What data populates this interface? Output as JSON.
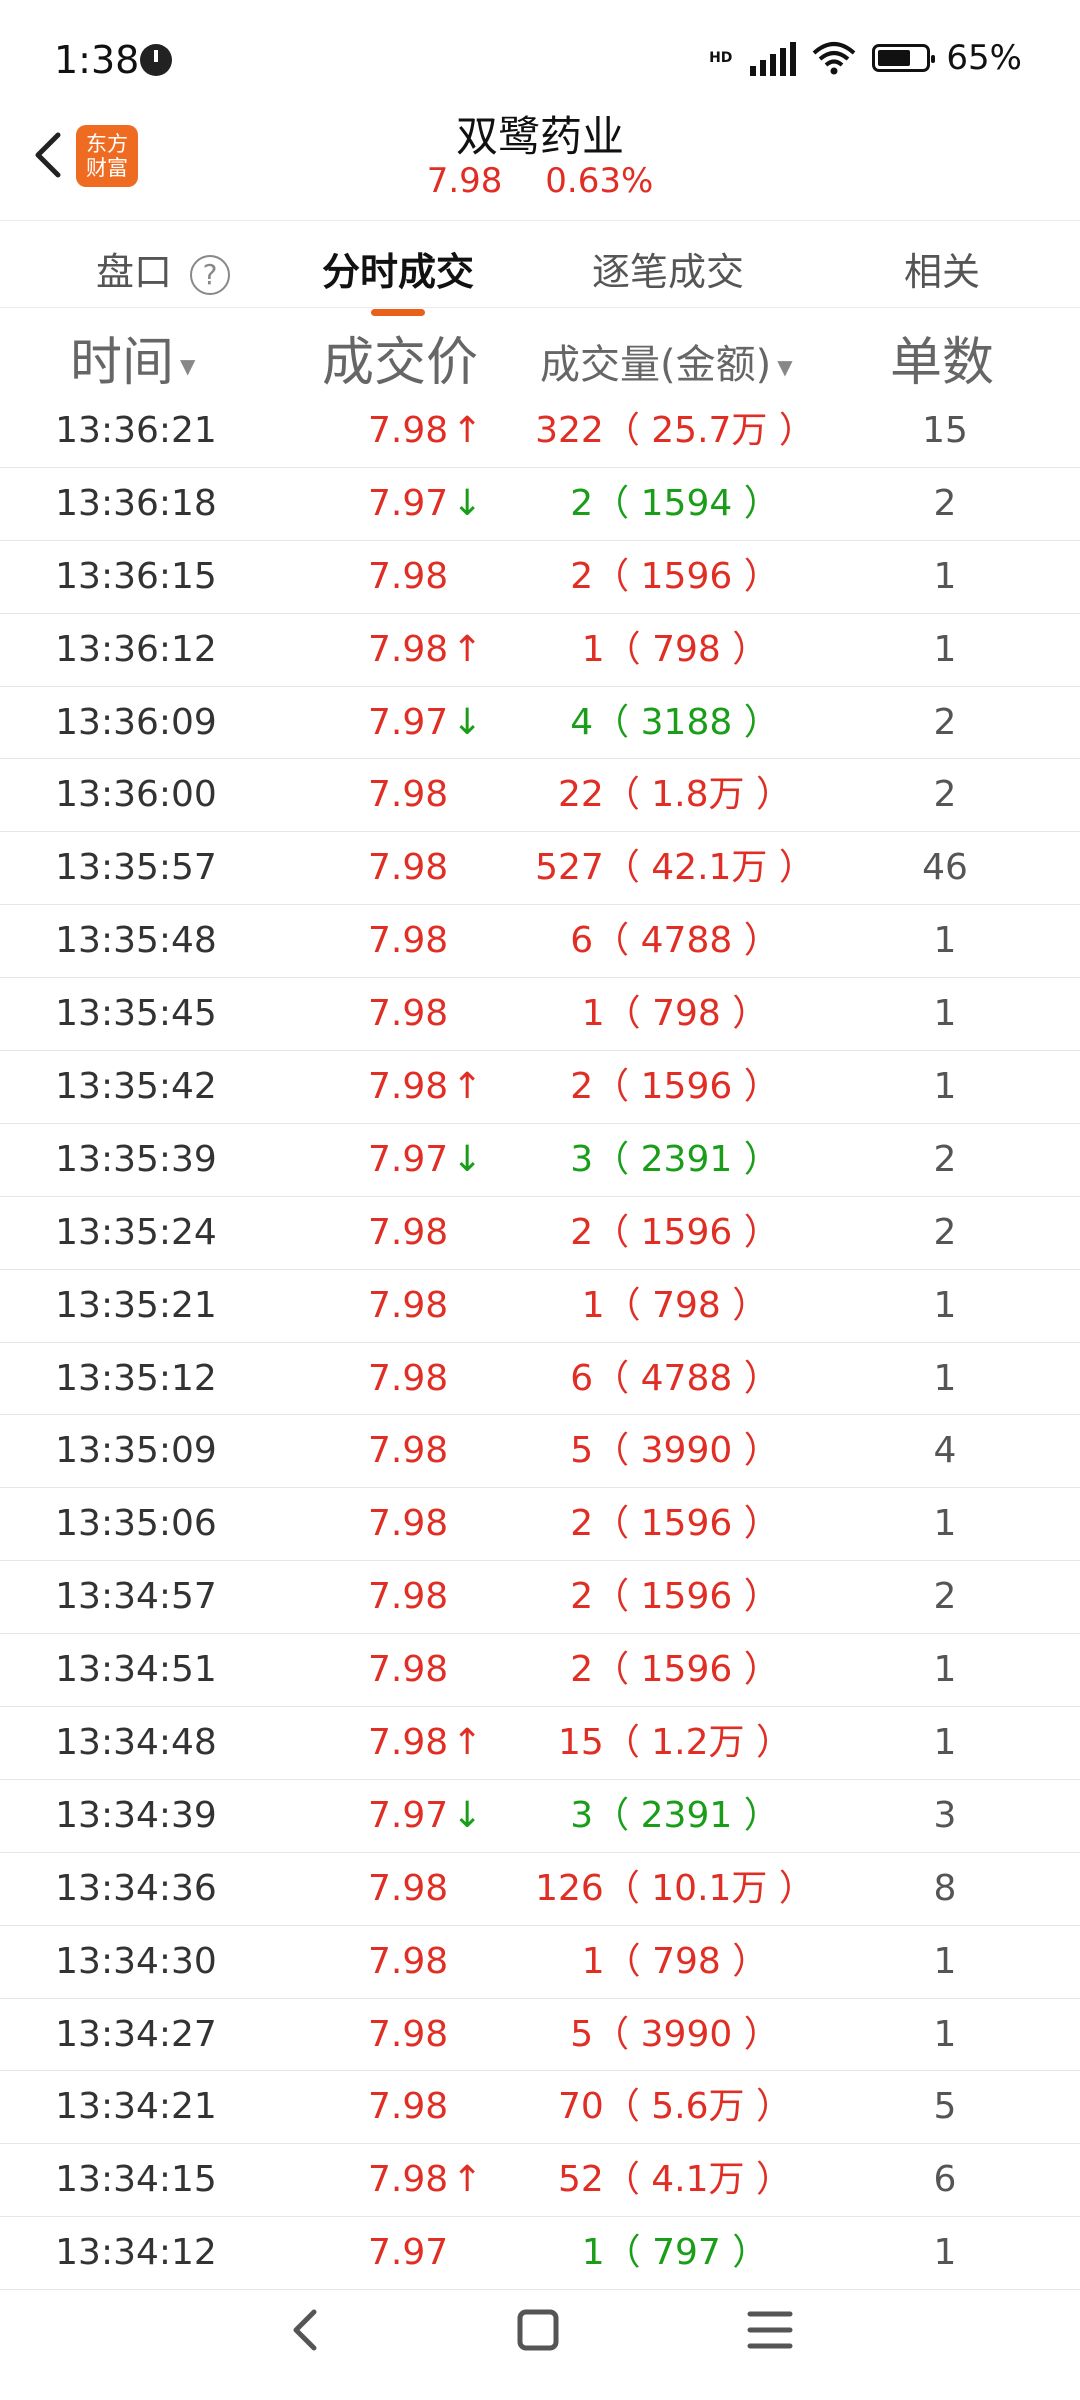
{
  "status": {
    "time": "1:38",
    "signal": "HD",
    "battery": "65%"
  },
  "header": {
    "title": "双鹭药业",
    "price": "7.98",
    "change": "0.63%",
    "logo_line1": "东方",
    "logo_line2": "财富"
  },
  "tabs": [
    {
      "label": "盘口",
      "active": false
    },
    {
      "label": "分时成交",
      "active": true
    },
    {
      "label": "逐笔成交",
      "active": false
    },
    {
      "label": "相关",
      "active": false
    }
  ],
  "columns": {
    "time": "时间",
    "price": "成交价",
    "volume": "成交量(金额)",
    "count": "单数"
  },
  "rows": [
    {
      "time": "13:36:21",
      "price": "7.98",
      "dir": "up",
      "volume": "322（ 25.7万 ）",
      "vcolor": "red",
      "count": "15"
    },
    {
      "time": "13:36:18",
      "price": "7.97",
      "dir": "down",
      "volume": "2（ 1594 ）",
      "vcolor": "green",
      "count": "2"
    },
    {
      "time": "13:36:15",
      "price": "7.98",
      "dir": "",
      "volume": "2（ 1596 ）",
      "vcolor": "red",
      "count": "1"
    },
    {
      "time": "13:36:12",
      "price": "7.98",
      "dir": "up",
      "volume": "1（ 798 ）",
      "vcolor": "red",
      "count": "1"
    },
    {
      "time": "13:36:09",
      "price": "7.97",
      "dir": "down",
      "volume": "4（ 3188 ）",
      "vcolor": "green",
      "count": "2"
    },
    {
      "time": "13:36:00",
      "price": "7.98",
      "dir": "",
      "volume": "22（ 1.8万 ）",
      "vcolor": "red",
      "count": "2"
    },
    {
      "time": "13:35:57",
      "price": "7.98",
      "dir": "",
      "volume": "527（ 42.1万 ）",
      "vcolor": "red",
      "count": "46"
    },
    {
      "time": "13:35:48",
      "price": "7.98",
      "dir": "",
      "volume": "6（ 4788 ）",
      "vcolor": "red",
      "count": "1"
    },
    {
      "time": "13:35:45",
      "price": "7.98",
      "dir": "",
      "volume": "1（ 798 ）",
      "vcolor": "red",
      "count": "1"
    },
    {
      "time": "13:35:42",
      "price": "7.98",
      "dir": "up",
      "volume": "2（ 1596 ）",
      "vcolor": "red",
      "count": "1"
    },
    {
      "time": "13:35:39",
      "price": "7.97",
      "dir": "down",
      "volume": "3（ 2391 ）",
      "vcolor": "green",
      "count": "2"
    },
    {
      "time": "13:35:24",
      "price": "7.98",
      "dir": "",
      "volume": "2（ 1596 ）",
      "vcolor": "red",
      "count": "2"
    },
    {
      "time": "13:35:21",
      "price": "7.98",
      "dir": "",
      "volume": "1（ 798 ）",
      "vcolor": "red",
      "count": "1"
    },
    {
      "time": "13:35:12",
      "price": "7.98",
      "dir": "",
      "volume": "6（ 4788 ）",
      "vcolor": "red",
      "count": "1"
    },
    {
      "time": "13:35:09",
      "price": "7.98",
      "dir": "",
      "volume": "5（ 3990 ）",
      "vcolor": "red",
      "count": "4"
    },
    {
      "time": "13:35:06",
      "price": "7.98",
      "dir": "",
      "volume": "2（ 1596 ）",
      "vcolor": "red",
      "count": "1"
    },
    {
      "time": "13:34:57",
      "price": "7.98",
      "dir": "",
      "volume": "2（ 1596 ）",
      "vcolor": "red",
      "count": "2"
    },
    {
      "time": "13:34:51",
      "price": "7.98",
      "dir": "",
      "volume": "2（ 1596 ）",
      "vcolor": "red",
      "count": "1"
    },
    {
      "time": "13:34:48",
      "price": "7.98",
      "dir": "up",
      "volume": "15（ 1.2万 ）",
      "vcolor": "red",
      "count": "1"
    },
    {
      "time": "13:34:39",
      "price": "7.97",
      "dir": "down",
      "volume": "3（ 2391 ）",
      "vcolor": "green",
      "count": "3"
    },
    {
      "time": "13:34:36",
      "price": "7.98",
      "dir": "",
      "volume": "126（ 10.1万 ）",
      "vcolor": "red",
      "count": "8"
    },
    {
      "time": "13:34:30",
      "price": "7.98",
      "dir": "",
      "volume": "1（ 798 ）",
      "vcolor": "red",
      "count": "1"
    },
    {
      "time": "13:34:27",
      "price": "7.98",
      "dir": "",
      "volume": "5（ 3990 ）",
      "vcolor": "red",
      "count": "1"
    },
    {
      "time": "13:34:21",
      "price": "7.98",
      "dir": "",
      "volume": "70（ 5.6万 ）",
      "vcolor": "red",
      "count": "5"
    },
    {
      "time": "13:34:15",
      "price": "7.98",
      "dir": "up",
      "volume": "52（ 4.1万 ）",
      "vcolor": "red",
      "count": "6"
    },
    {
      "time": "13:34:12",
      "price": "7.97",
      "dir": "",
      "volume": "1（ 797 ）",
      "vcolor": "green",
      "count": "1"
    }
  ],
  "colors": {
    "up": "#e02e24",
    "down": "#1a9e1a",
    "accent": "#e8601c"
  }
}
